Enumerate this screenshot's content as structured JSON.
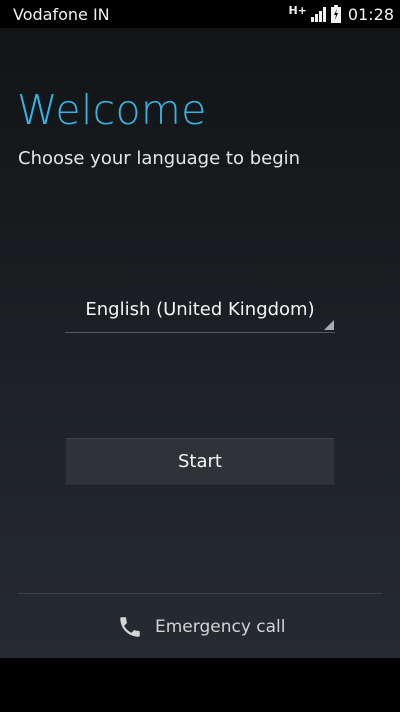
{
  "status_bar": {
    "carrier": "Vodafone IN",
    "network_type": "H+",
    "time": "01:28",
    "icons": [
      "signal-icon",
      "battery-icon"
    ]
  },
  "setup": {
    "title": "Welcome",
    "subtitle": "Choose your language to begin",
    "language_selected": "English (United Kingdom)",
    "start_label": "Start",
    "emergency_label": "Emergency call"
  },
  "colors": {
    "accent": "#33b5e5",
    "background_top": "#121416",
    "background_bottom": "#262b31",
    "button": "#2f3338"
  }
}
